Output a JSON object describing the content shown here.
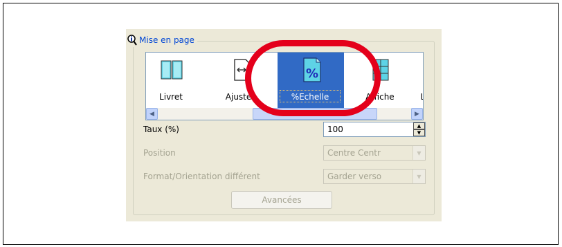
{
  "group": {
    "legend": "Mise en page",
    "info_icon": "info-magnifier-icon"
  },
  "carousel": {
    "items": [
      {
        "label": "Livret",
        "icon": "booklet-icon",
        "selected": false
      },
      {
        "label": "Ajuster",
        "icon": "fit-to-page-icon",
        "selected": false
      },
      {
        "label": "%Echelle",
        "icon": "percent-scale-icon",
        "selected": true
      },
      {
        "label": "Affiche",
        "icon": "poster-icon",
        "selected": false
      },
      {
        "label": "L",
        "icon": "layout-icon",
        "selected": false
      }
    ],
    "scroll_left": "scroll-left-arrow-icon",
    "scroll_right": "scroll-right-arrow-icon"
  },
  "rate": {
    "label": "Taux (%)",
    "value": "100"
  },
  "position": {
    "label": "Position",
    "value": "Centre Centr"
  },
  "format": {
    "label": "Format/Orientation différent",
    "value": "Garder verso"
  },
  "advanced_button": "Avancées",
  "colors": {
    "highlight": "#e4001b",
    "selection": "#316ac5",
    "dialog_bg": "#ece9d8"
  }
}
